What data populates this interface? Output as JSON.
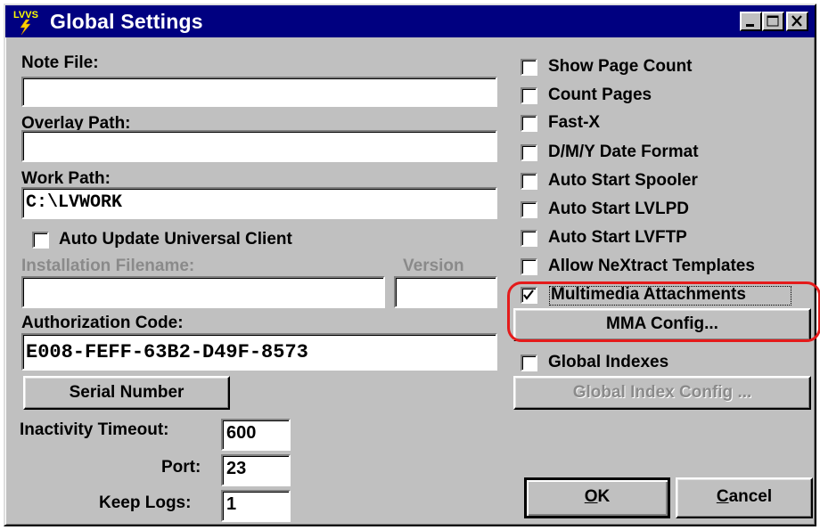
{
  "window": {
    "title": "Global Settings",
    "logo_text": "LVVS",
    "controls": [
      "minimize-icon",
      "maximize-icon",
      "close-icon"
    ]
  },
  "left": {
    "note_file": {
      "label": "Note File:",
      "value": ""
    },
    "overlay_path": {
      "label": "Overlay Path:",
      "value": ""
    },
    "work_path": {
      "label": "Work Path:",
      "value": "C:\\LVWORK"
    },
    "auto_update": {
      "label": "Auto Update Universal Client",
      "checked": false
    },
    "installation": {
      "label": "Installation Filename:",
      "value": "",
      "disabled": true
    },
    "version": {
      "label": "Version",
      "value": "",
      "disabled": true
    },
    "authorization": {
      "label": "Authorization Code:",
      "value": "E008-FEFF-63B2-D49F-8573"
    },
    "serial_button": "Serial Number",
    "inactivity": {
      "label": "Inactivity Timeout:",
      "value": "600"
    },
    "port": {
      "label": "Port:",
      "value": "23"
    },
    "keep_logs": {
      "label": "Keep Logs:",
      "value": "1"
    }
  },
  "right": {
    "options": [
      {
        "label": "Show Page Count",
        "checked": false
      },
      {
        "label": "Count Pages",
        "checked": false
      },
      {
        "label": "Fast-X",
        "checked": false
      },
      {
        "label": "D/M/Y Date Format",
        "checked": false
      },
      {
        "label": "Auto Start Spooler",
        "checked": false
      },
      {
        "label": "Auto Start LVLPD",
        "checked": false
      },
      {
        "label": "Auto Start LVFTP",
        "checked": false
      },
      {
        "label": "Allow NeXtract Templates",
        "checked": false
      }
    ],
    "mma": {
      "label": "Multimedia Attachments",
      "checked": true
    },
    "mma_config_button": "MMA Config...",
    "global_indexes": {
      "label": "Global Indexes",
      "checked": false
    },
    "global_index_config_button": "Global Index Config ..."
  },
  "footer": {
    "ok_label": "OK",
    "ok_mnemonic": "O",
    "ok_rest": "K",
    "cancel_label": "Cancel",
    "cancel_mnemonic": "C",
    "cancel_rest": "ancel"
  },
  "colors": {
    "titlebar": "#000080",
    "face": "#c0c0c0",
    "highlight": "#e41b1b"
  }
}
